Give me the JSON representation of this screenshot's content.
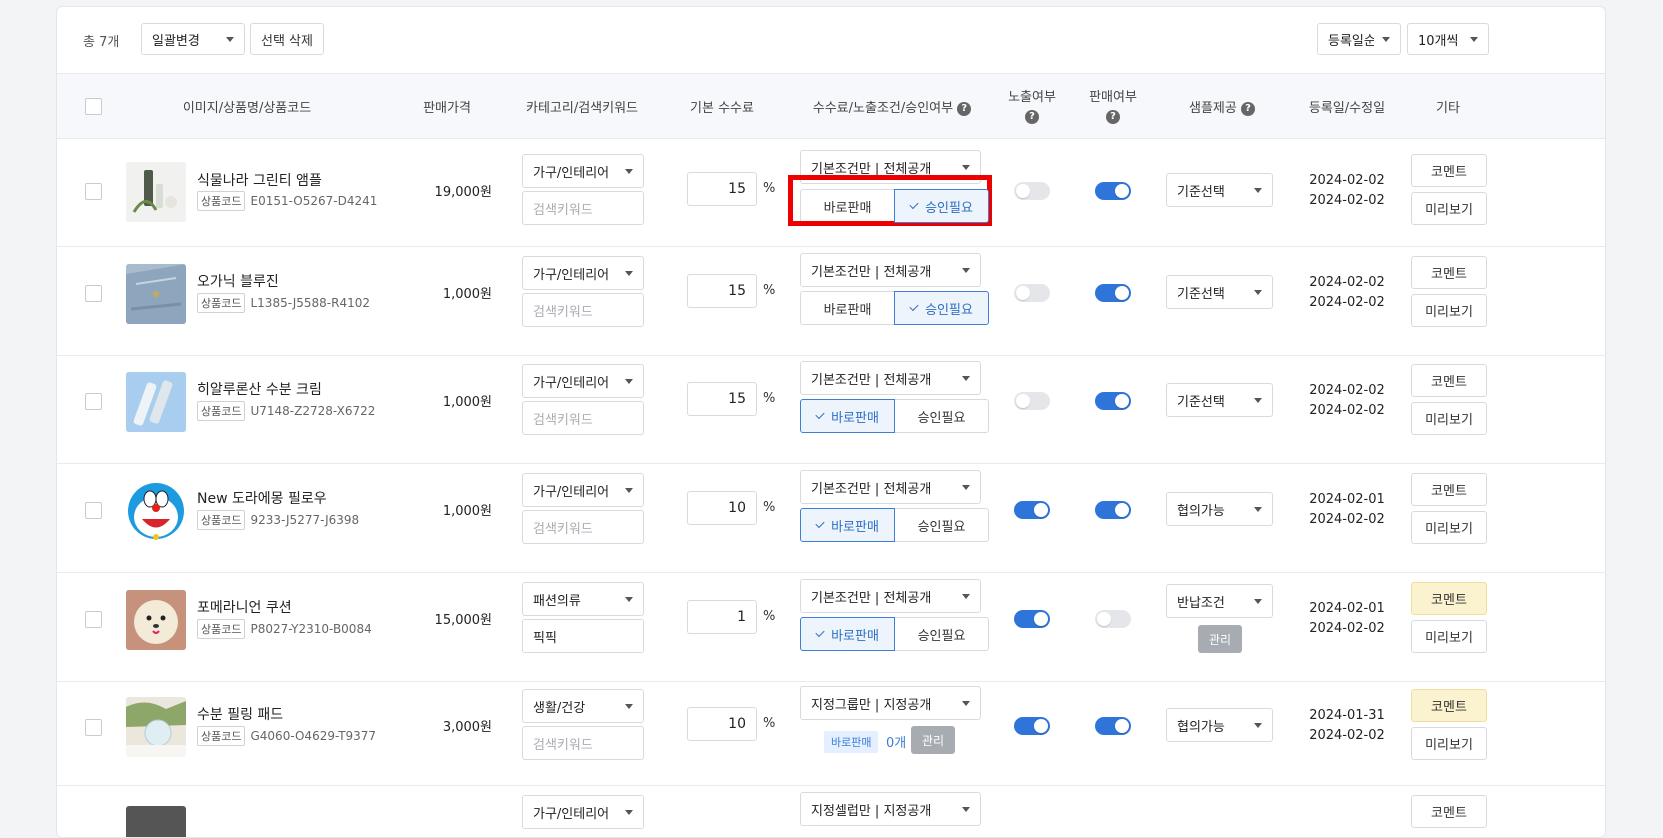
{
  "toolbar": {
    "total": "총 7개",
    "bulk_change": "일괄변경",
    "delete_selected": "선택 삭제",
    "sort": "등록일순",
    "per_page": "10개씩"
  },
  "headers": {
    "product": "이미지/상품명/상품코드",
    "price": "판매가격",
    "category": "카테고리/검색키워드",
    "fee": "기본 수수료",
    "conditions": "수수료/노출조건/승인여부",
    "exposure": "노출여부",
    "selling": "판매여부",
    "sample": "샘플제공",
    "dates": "등록일/수정일",
    "etc": "기타"
  },
  "labels": {
    "code_tag": "상품코드",
    "keyword_placeholder": "검색키워드",
    "percent": "%",
    "instant": "바로판매",
    "approval": "승인필요",
    "comment": "코멘트",
    "preview": "미리보기",
    "manage": "관리",
    "help": "?"
  },
  "rows": [
    {
      "name": "식물나라 그린티 앰플",
      "code": "E0151-O5267-D4241",
      "price": "19,000원",
      "category": "가구/인테리어",
      "keyword": "",
      "fee": "15",
      "condition": "기본조건만 | 전체공개",
      "approval_selected": "approval",
      "exposure": false,
      "selling": true,
      "sample": "기준선택",
      "registered": "2024-02-02",
      "modified": "2024-02-02",
      "comment_highlight": false
    },
    {
      "name": "오가닉 블루진",
      "code": "L1385-J5588-R4102",
      "price": "1,000원",
      "category": "가구/인테리어",
      "keyword": "",
      "fee": "15",
      "condition": "기본조건만 | 전체공개",
      "approval_selected": "approval",
      "exposure": false,
      "selling": true,
      "sample": "기준선택",
      "registered": "2024-02-02",
      "modified": "2024-02-02",
      "comment_highlight": false
    },
    {
      "name": "히알루론산 수분 크림",
      "code": "U7148-Z2728-X6722",
      "price": "1,000원",
      "category": "가구/인테리어",
      "keyword": "",
      "fee": "15",
      "condition": "기본조건만 | 전체공개",
      "approval_selected": "instant",
      "exposure": false,
      "selling": true,
      "sample": "기준선택",
      "registered": "2024-02-02",
      "modified": "2024-02-02",
      "comment_highlight": false
    },
    {
      "name": "New 도라에몽 필로우",
      "code": "9233-J5277-J6398",
      "price": "1,000원",
      "category": "가구/인테리어",
      "keyword": "",
      "fee": "10",
      "condition": "기본조건만 | 전체공개",
      "approval_selected": "instant",
      "exposure": true,
      "selling": true,
      "sample": "협의가능",
      "registered": "2024-02-01",
      "modified": "2024-02-02",
      "comment_highlight": false
    },
    {
      "name": "포메라니언 쿠션",
      "code": "P8027-Y2310-B0084",
      "price": "15,000원",
      "category": "패션의류",
      "keyword": "픽픽",
      "fee": "1",
      "condition": "기본조건만 | 전체공개",
      "approval_selected": "instant",
      "exposure": true,
      "selling": false,
      "sample": "반납조건",
      "sample_manage": true,
      "registered": "2024-02-01",
      "modified": "2024-02-02",
      "comment_highlight": true
    },
    {
      "name": "수분 필링 패드",
      "code": "G4060-O4629-T9377",
      "price": "3,000원",
      "category": "생활/건강",
      "keyword": "",
      "fee": "10",
      "condition": "지정그룹만 | 지정공개",
      "approval_mode": "group",
      "group_count": "0개",
      "exposure": true,
      "selling": true,
      "sample": "협의가능",
      "registered": "2024-01-31",
      "modified": "2024-02-02",
      "comment_highlight": true
    },
    {
      "category": "가구/인테리어",
      "condition": "지정셀럽만 | 지정공개"
    }
  ]
}
